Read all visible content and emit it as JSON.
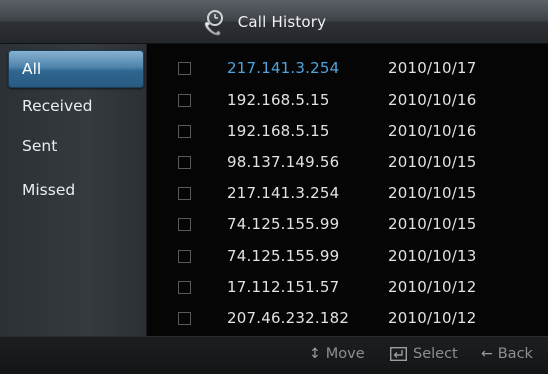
{
  "title": "Call History",
  "title_icon": "phone-icon",
  "sidebar": {
    "items": [
      {
        "label": "All",
        "active": true
      },
      {
        "label": "Received",
        "active": false
      },
      {
        "label": "Sent",
        "active": false
      },
      {
        "label": "Missed",
        "active": false
      }
    ]
  },
  "calls": [
    {
      "ip": "217.141.3.254",
      "date": "2010/10/17",
      "selected": true
    },
    {
      "ip": "192.168.5.15",
      "date": "2010/10/16",
      "selected": false
    },
    {
      "ip": "192.168.5.15",
      "date": "2010/10/16",
      "selected": false
    },
    {
      "ip": "98.137.149.56",
      "date": "2010/10/15",
      "selected": false
    },
    {
      "ip": "217.141.3.254",
      "date": "2010/10/15",
      "selected": false
    },
    {
      "ip": "74.125.155.99",
      "date": "2010/10/15",
      "selected": false
    },
    {
      "ip": "74.125.155.99",
      "date": "2010/10/13",
      "selected": false
    },
    {
      "ip": "17.112.151.57",
      "date": "2010/10/12",
      "selected": false
    },
    {
      "ip": "207.46.232.182",
      "date": "2010/10/12",
      "selected": false
    }
  ],
  "footer": {
    "move_label": "Move",
    "select_label": "Select",
    "back_label": "Back"
  },
  "colors": {
    "accent": "#4fa3de",
    "active_item": "#3a75a0"
  }
}
